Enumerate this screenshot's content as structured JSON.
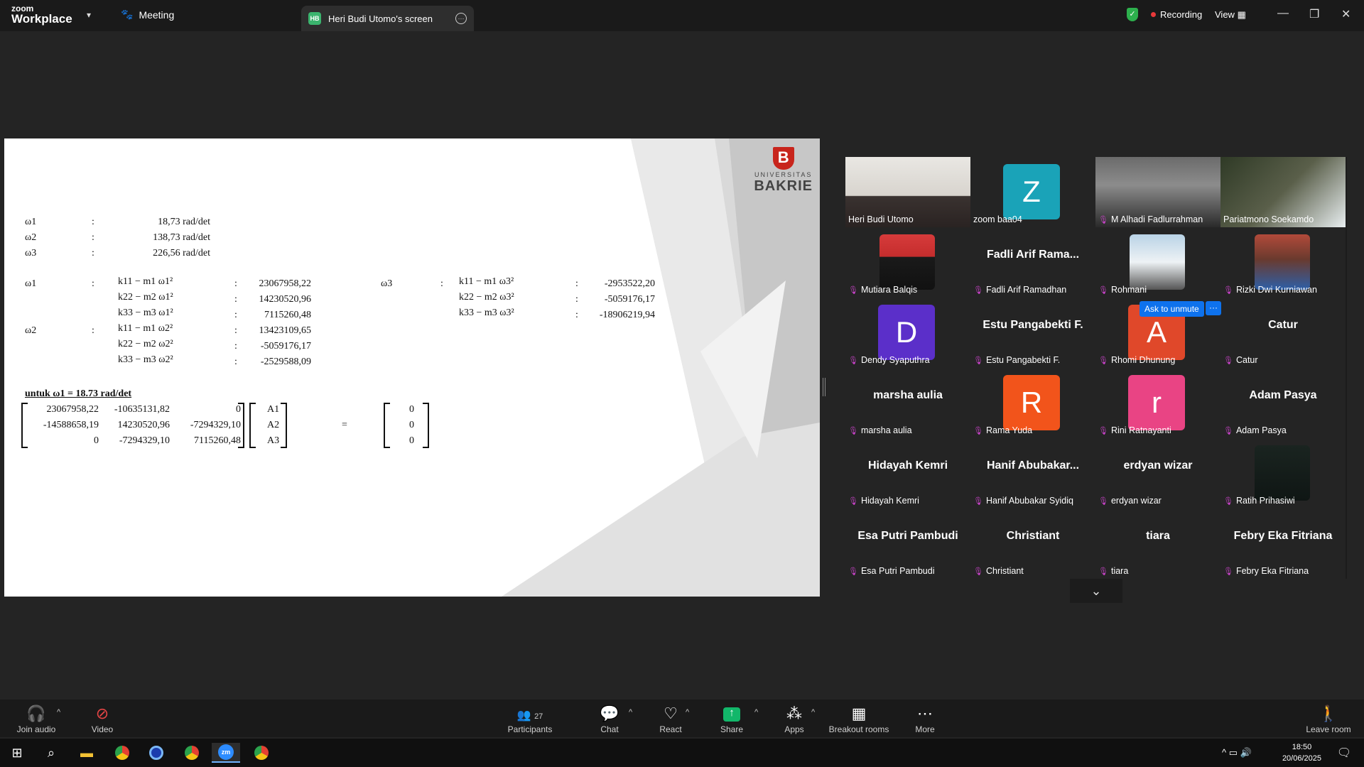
{
  "topbar": {
    "logo_line1": "zoom",
    "logo_line2": "Workplace",
    "meeting_label": "Meeting",
    "share_tab_initials": "HB",
    "share_tab_label": "Heri Budi Utomo's screen",
    "recording_label": "Recording",
    "view_label": "View",
    "accent": "#2db04d",
    "record_color": "#e8393a"
  },
  "slide": {
    "brand_university": "UNIVERSITAS",
    "brand_name": "BAKRIE",
    "freq": [
      {
        "label": "ω1",
        "sep": ":",
        "value": "18,73 rad/det"
      },
      {
        "label": "ω2",
        "sep": ":",
        "value": "138,73 rad/det"
      },
      {
        "label": "ω3",
        "sep": ":",
        "value": "226,56 rad/det"
      }
    ],
    "w1_label": "ω1",
    "w2_label": "ω2",
    "w3_label": "ω3",
    "colon": ":",
    "w1_rows": [
      {
        "expr": "k11 − m1 ω1²",
        "value": "23067958,22"
      },
      {
        "expr": "k22 − m2 ω1²",
        "value": "14230520,96"
      },
      {
        "expr": "k33 − m3 ω1²",
        "value": "7115260,48"
      }
    ],
    "w2_rows": [
      {
        "expr": "k11 − m1 ω2²",
        "value": "13423109,65"
      },
      {
        "expr": "k22 − m2 ω2²",
        "value": "-5059176,17"
      },
      {
        "expr": "k33 − m3 ω2²",
        "value": "-2529588,09"
      }
    ],
    "w3_rows": [
      {
        "expr": "k11 − m1 ω3²",
        "value": "-2953522,20"
      },
      {
        "expr": "k22 − m2 ω3²",
        "value": "-5059176,17"
      },
      {
        "expr": "k33 − m3 ω3²",
        "value": "-18906219,94"
      }
    ],
    "untuk_heading": "untuk ω1 = 18.73 rad/det",
    "matrix": [
      [
        "23067958,22",
        "-10635131,82",
        "0"
      ],
      [
        "-14588658,19",
        "14230520,96",
        "-7294329,10"
      ],
      [
        "0",
        "-7294329,10",
        "7115260,48"
      ]
    ],
    "vector_a": [
      "A1",
      "A2",
      "A3"
    ],
    "equals": "=",
    "vector_zero": [
      "0",
      "0",
      "0"
    ]
  },
  "gallery": {
    "ask_to_unmute": "Ask to unmute",
    "ask_more": "···",
    "tiles": [
      {
        "name": "Heri Budi Utomo",
        "big": ""
      },
      {
        "name": "zoom baa04",
        "big": "",
        "letter": "Z",
        "color": "#1aa3b8"
      },
      {
        "name": "M Alhadi Fadlurrahman",
        "big": ""
      },
      {
        "name": "Pariatmono Soekamdo",
        "big": ""
      },
      {
        "name": "Mutiara Balqis",
        "big": ""
      },
      {
        "name": "Fadli Arif Ramadhan",
        "big": "Fadli Arif Rama..."
      },
      {
        "name": "Rohmani",
        "big": ""
      },
      {
        "name": "Rizki Dwi Kurniawan",
        "big": ""
      },
      {
        "name": "Dendy Syaputhra",
        "big": "",
        "letter": "D",
        "color": "#5b2fc9"
      },
      {
        "name": "Estu Pangabekti F.",
        "big": "Estu Pangabekti F."
      },
      {
        "name": "Rhomi Dhunung",
        "big": "",
        "letter": "A",
        "color": "#e0482a"
      },
      {
        "name": "Catur",
        "big": "Catur"
      },
      {
        "name": "marsha aulia",
        "big": "marsha aulia"
      },
      {
        "name": "Rama Yuda",
        "big": "",
        "letter": "R",
        "color": "#f2541b"
      },
      {
        "name": "Rini Ratnayanti",
        "big": "",
        "letter": "r",
        "color": "#e94484"
      },
      {
        "name": "Adam Pasya",
        "big": "Adam Pasya"
      },
      {
        "name": "Hidayah Kemri",
        "big": "Hidayah Kemri"
      },
      {
        "name": "Hanif Abubakar Syidiq",
        "big": "Hanif  Abubakar..."
      },
      {
        "name": "erdyan wizar",
        "big": "erdyan wizar"
      },
      {
        "name": "Ratih Prihasiwi",
        "big": ""
      },
      {
        "name": "Esa Putri Pambudi",
        "big": "Esa Putri Pambudi"
      },
      {
        "name": "Christiant",
        "big": "Christiant"
      },
      {
        "name": "tiara",
        "big": "tiara"
      },
      {
        "name": "Febry Eka Fitriana",
        "big": "Febry Eka Fitriana"
      }
    ]
  },
  "toolbar": {
    "join_audio": "Join audio",
    "video": "Video",
    "participants": "Participants",
    "participants_count": "27",
    "chat": "Chat",
    "react": "React",
    "share": "Share",
    "apps": "Apps",
    "breakout": "Breakout rooms",
    "more": "More",
    "leave": "Leave room",
    "share_color": "#12b76a"
  },
  "taskbar": {
    "time": "18:50",
    "date": "20/06/2025"
  }
}
